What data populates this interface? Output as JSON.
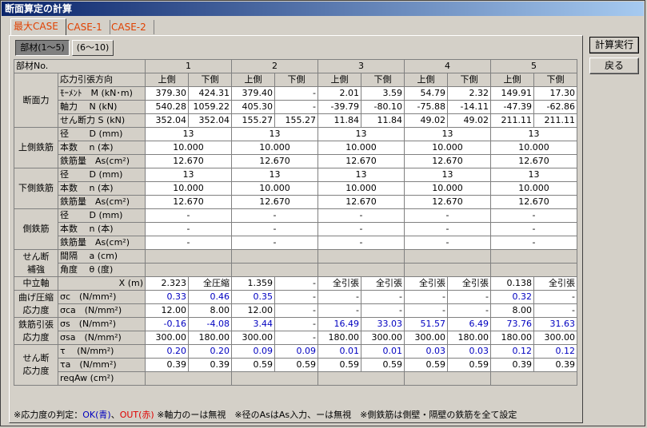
{
  "window": {
    "title": "断面算定の計算"
  },
  "tabs": [
    "最大CASE",
    "CASE-1",
    "CASE-2"
  ],
  "subtabs": [
    "部材(1～5)",
    "(6～10)"
  ],
  "buttons": {
    "calc": "計算実行",
    "back": "戻る"
  },
  "header": {
    "member_label": "部材No.",
    "members": [
      "1",
      "2",
      "3",
      "4",
      "5"
    ],
    "direction_label": "応力引張方向",
    "upper": "上側",
    "lower": "下側"
  },
  "groups": {
    "section_force": "断面力",
    "upper_rebar": "上側鉄筋",
    "lower_rebar": "下側鉄筋",
    "side_rebar": "側鉄筋",
    "shear_reinf_1": "せん断",
    "shear_reinf_2": "補強",
    "neutral_axis": "中立軸",
    "bend_1": "曲げ圧縮",
    "bend_2": "応力度",
    "tens_1": "鉄筋引張",
    "tens_2": "応力度",
    "shear_1": "せん断",
    "shear_2": "応力度"
  },
  "row_labels": {
    "moment": "ﾓｰﾒﾝﾄ　M (kN･m)",
    "axial": "軸力　 N (kN)",
    "shear": "せん断力 S (kN)",
    "diam": "径　　 D (mm)",
    "count": "本数　 n (本)",
    "area": "鉄筋量　As(cm²)",
    "spacing": "間隔　 a (cm)",
    "angle": "角度　 θ (度)",
    "x": "X (m)",
    "sc": "σc　(N/mm²)",
    "sca": "σca　(N/mm²)",
    "ss": "σs　(N/mm²)",
    "ssa": "σsa　(N/mm²)",
    "tau": "τ　 (N/mm²)",
    "taua": "τa　(N/mm²)",
    "reqaw": "reqAw (cm²)"
  },
  "values": {
    "moment": [
      "379.30",
      "424.31",
      "379.40",
      "-",
      "2.01",
      "3.59",
      "54.79",
      "2.32",
      "149.91",
      "17.30"
    ],
    "axial": [
      "540.28",
      "1059.22",
      "405.30",
      "-",
      "-39.79",
      "-80.10",
      "-75.88",
      "-14.11",
      "-47.39",
      "-62.86"
    ],
    "shear": [
      "352.04",
      "352.04",
      "155.27",
      "155.27",
      "11.84",
      "11.84",
      "49.02",
      "49.02",
      "211.11",
      "211.11"
    ],
    "upper_diam": [
      "13",
      "13",
      "13",
      "13",
      "13"
    ],
    "upper_count": [
      "10.000",
      "10.000",
      "10.000",
      "10.000",
      "10.000"
    ],
    "upper_area": [
      "12.670",
      "12.670",
      "12.670",
      "12.670",
      "12.670"
    ],
    "lower_diam": [
      "13",
      "13",
      "13",
      "13",
      "13"
    ],
    "lower_count": [
      "10.000",
      "10.000",
      "10.000",
      "10.000",
      "10.000"
    ],
    "lower_area": [
      "12.670",
      "12.670",
      "12.670",
      "12.670",
      "12.670"
    ],
    "side_diam": [
      "-",
      "-",
      "-",
      "-",
      "-"
    ],
    "side_count": [
      "-",
      "-",
      "-",
      "-",
      "-"
    ],
    "side_area": [
      "-",
      "-",
      "-",
      "-",
      "-"
    ],
    "x": [
      "2.323",
      "全圧縮",
      "1.359",
      "-",
      "全引張",
      "全引張",
      "全引張",
      "全引張",
      "0.138",
      "全引張"
    ],
    "sc": [
      "0.33",
      "0.46",
      "0.35",
      "-",
      "-",
      "-",
      "-",
      "-",
      "0.32",
      "-"
    ],
    "sca": [
      "12.00",
      "8.00",
      "12.00",
      "-",
      "-",
      "-",
      "-",
      "-",
      "8.00",
      "-"
    ],
    "ss": [
      "-0.16",
      "-4.08",
      "3.44",
      "-",
      "16.49",
      "33.03",
      "51.57",
      "6.49",
      "73.76",
      "31.63"
    ],
    "ssa": [
      "300.00",
      "180.00",
      "300.00",
      "-",
      "180.00",
      "300.00",
      "300.00",
      "180.00",
      "180.00",
      "300.00"
    ],
    "tau": [
      "0.20",
      "0.20",
      "0.09",
      "0.09",
      "0.01",
      "0.01",
      "0.03",
      "0.03",
      "0.12",
      "0.12"
    ],
    "taua": [
      "0.39",
      "0.39",
      "0.59",
      "0.59",
      "0.59",
      "0.59",
      "0.59",
      "0.59",
      "0.39",
      "0.39"
    ]
  },
  "footnote": {
    "prefix": "※応力度の判定：",
    "ok": "OK(青)",
    "sep": "、",
    "ng": "OUT(赤)",
    "rest": " ※軸力のーは無視　※径のAsはAs入力、ーは無視　※側鉄筋は側壁・隔壁の鉄筋を全て設定"
  },
  "colors": {
    "ok": "#0000c0",
    "ng": "#e00000",
    "title_bar": "#0a246a"
  }
}
